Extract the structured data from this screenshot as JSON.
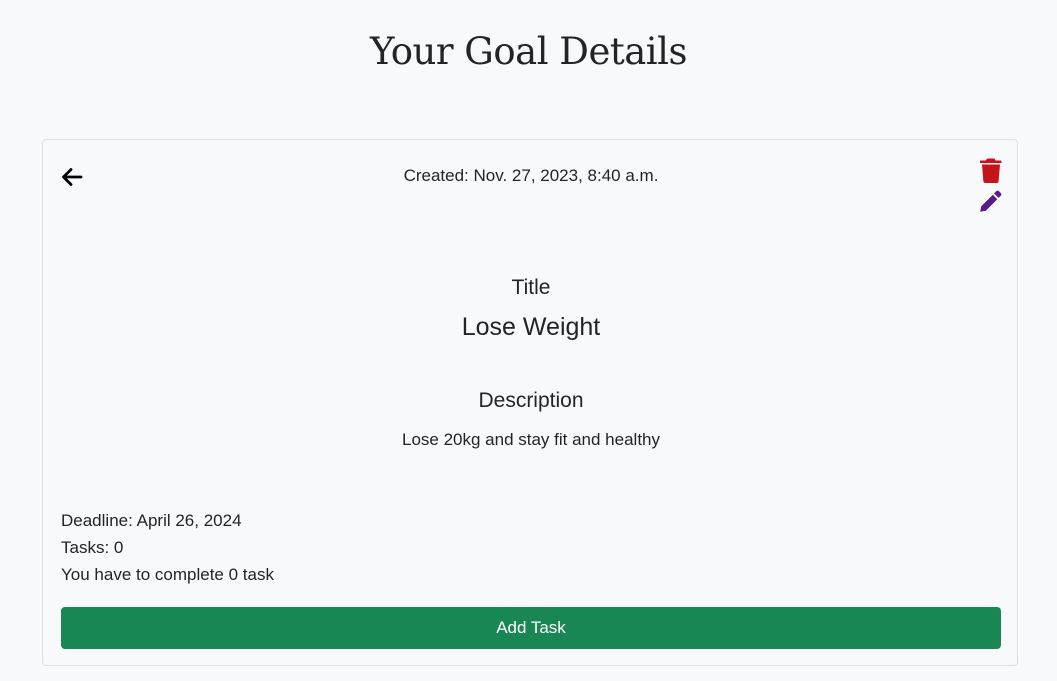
{
  "page": {
    "title": "Your Goal Details"
  },
  "goal": {
    "created": "Created: Nov. 27, 2023, 8:40 a.m.",
    "title_label": "Title",
    "title": "Lose Weight",
    "description_label": "Description",
    "description": "Lose 20kg and stay fit and healthy",
    "deadline": "Deadline: April 26, 2024",
    "tasks": "Tasks: 0",
    "remaining": "You have to complete 0 task"
  },
  "actions": {
    "back_icon": "arrow-left-icon",
    "delete_icon": "trash-icon",
    "edit_icon": "pencil-icon",
    "add_task_label": "Add Task"
  },
  "colors": {
    "delete": "#c4131a",
    "edit": "#5a1a86",
    "add_task": "#198754"
  }
}
